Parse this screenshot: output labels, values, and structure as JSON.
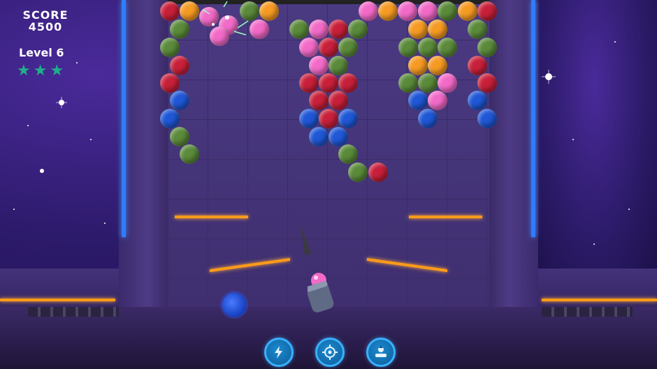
{
  "hud": {
    "score_label": "SCORE",
    "score_value": "4500",
    "level_label": "Level 6",
    "stars": 3
  },
  "colors": {
    "red": "#c8203a",
    "orange": "#f59a22",
    "green": "#5a8a3a",
    "pink": "#f26ac8",
    "blue": "#1f57d6",
    "neon_accent": "#ff9a1a",
    "button_ring": "#3ab0ff"
  },
  "board": {
    "loaded_bubble_color": "pink",
    "next_bubble_color": "blue"
  },
  "powerups": [
    {
      "name": "lightning-powerup",
      "icon": "lightning-icon"
    },
    {
      "name": "aim-powerup",
      "icon": "crosshair-icon"
    },
    {
      "name": "swap-powerup",
      "icon": "bubble-swap-icon"
    }
  ]
}
